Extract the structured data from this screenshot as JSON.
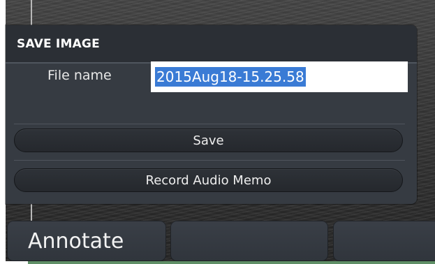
{
  "dialog": {
    "title": "SAVE IMAGE",
    "file_name_label": "File name",
    "file_name_value": "2015Aug18-15.25.58",
    "save_label": "Save",
    "record_audio_label": "Record Audio Memo"
  },
  "toolbar": {
    "annotate_label": "Annotate",
    "button2_label": "",
    "button3_label": ""
  },
  "colors": {
    "dialog_bg": "#363b42",
    "header_bg": "#2b2f35",
    "selection": "#3a7bd5",
    "bottom_strip": "#5f8f66"
  }
}
